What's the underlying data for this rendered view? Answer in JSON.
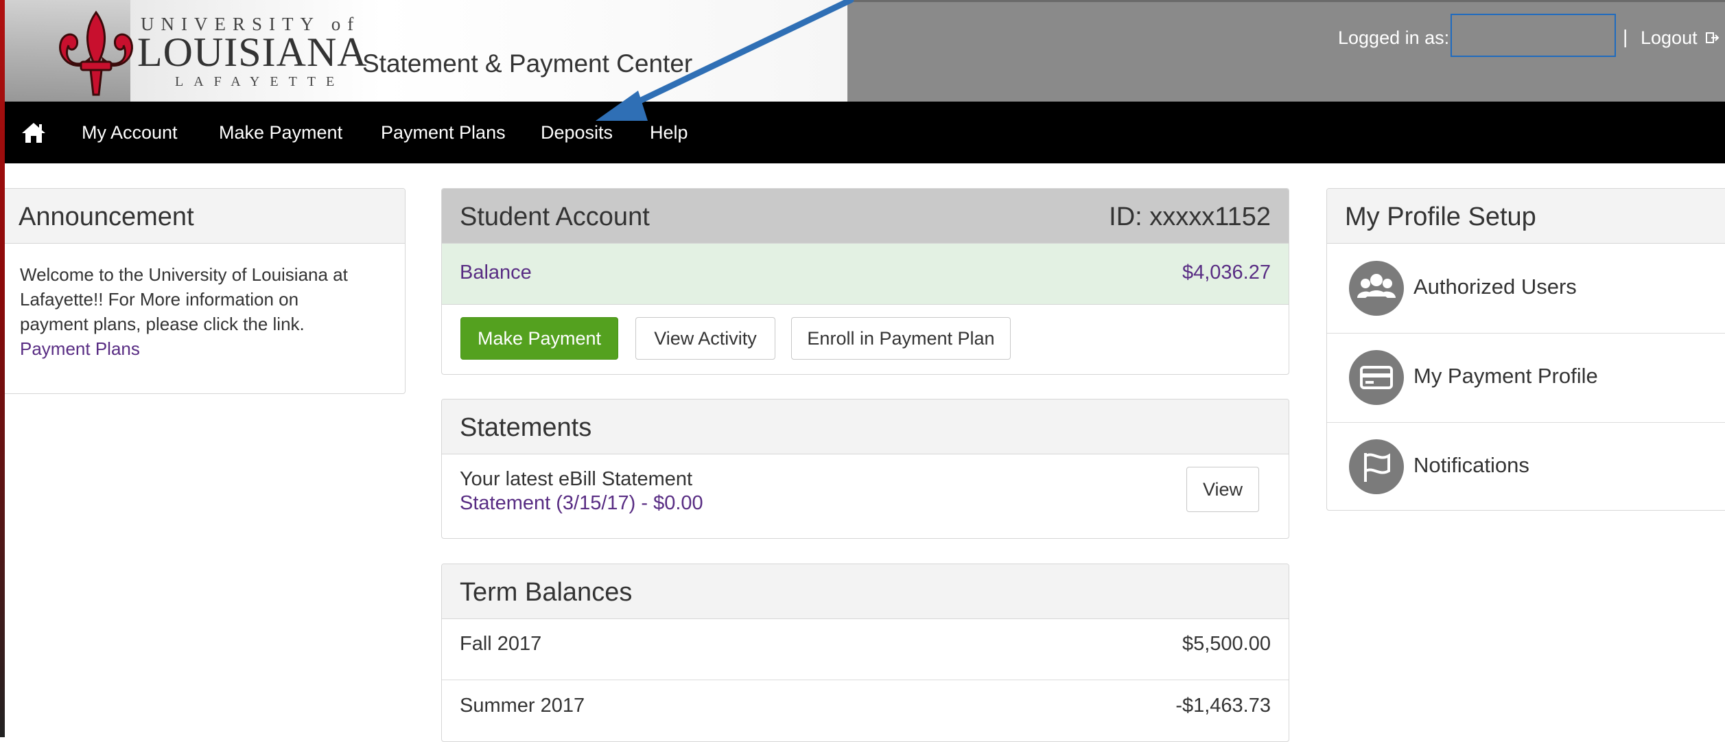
{
  "header": {
    "logo_top": "UNIVERSITY of",
    "logo_main": "LOUISIANA",
    "logo_bottom": "LAFAYETTE",
    "app_title": "Statement & Payment Center",
    "logged_in_label": "Logged in as:",
    "username_value": "",
    "separator": "|",
    "logout_label": "Logout"
  },
  "nav": {
    "items": [
      {
        "label": "My Account"
      },
      {
        "label": "Make Payment"
      },
      {
        "label": "Payment Plans"
      },
      {
        "label": "Deposits"
      },
      {
        "label": "Help"
      }
    ]
  },
  "announcement": {
    "title": "Announcement",
    "body_lines": [
      "Welcome to the University of Louisiana at",
      "Lafayette!! For More information on",
      "payment plans, please click the link."
    ],
    "link": "Payment Plans"
  },
  "student_account": {
    "title": "Student Account",
    "id_label": "ID: xxxxx1152",
    "balance_label": "Balance",
    "balance_value": "$4,036.27",
    "buttons": {
      "make_payment": "Make Payment",
      "view_activity": "View Activity",
      "enroll": "Enroll in Payment Plan"
    }
  },
  "statements": {
    "title": "Statements",
    "latest_label": "Your latest eBill Statement",
    "statement_link": "Statement (3/15/17) - $0.00",
    "view_button": "View"
  },
  "term_balances": {
    "title": "Term Balances",
    "rows": [
      {
        "term": "Fall 2017",
        "amount": "$5,500.00"
      },
      {
        "term": "Summer 2017",
        "amount": "-$1,463.73"
      }
    ]
  },
  "profile": {
    "title": "My Profile Setup",
    "items": [
      {
        "label": "Authorized Users",
        "icon": "users-icon"
      },
      {
        "label": "My Payment Profile",
        "icon": "credit-card-icon"
      },
      {
        "label": "Notifications",
        "icon": "flag-icon"
      }
    ]
  },
  "colors": {
    "accent_green": "#54a11f",
    "link_purple": "#582c83",
    "arrow_blue": "#2f6fb5",
    "nav_black": "#000000"
  }
}
